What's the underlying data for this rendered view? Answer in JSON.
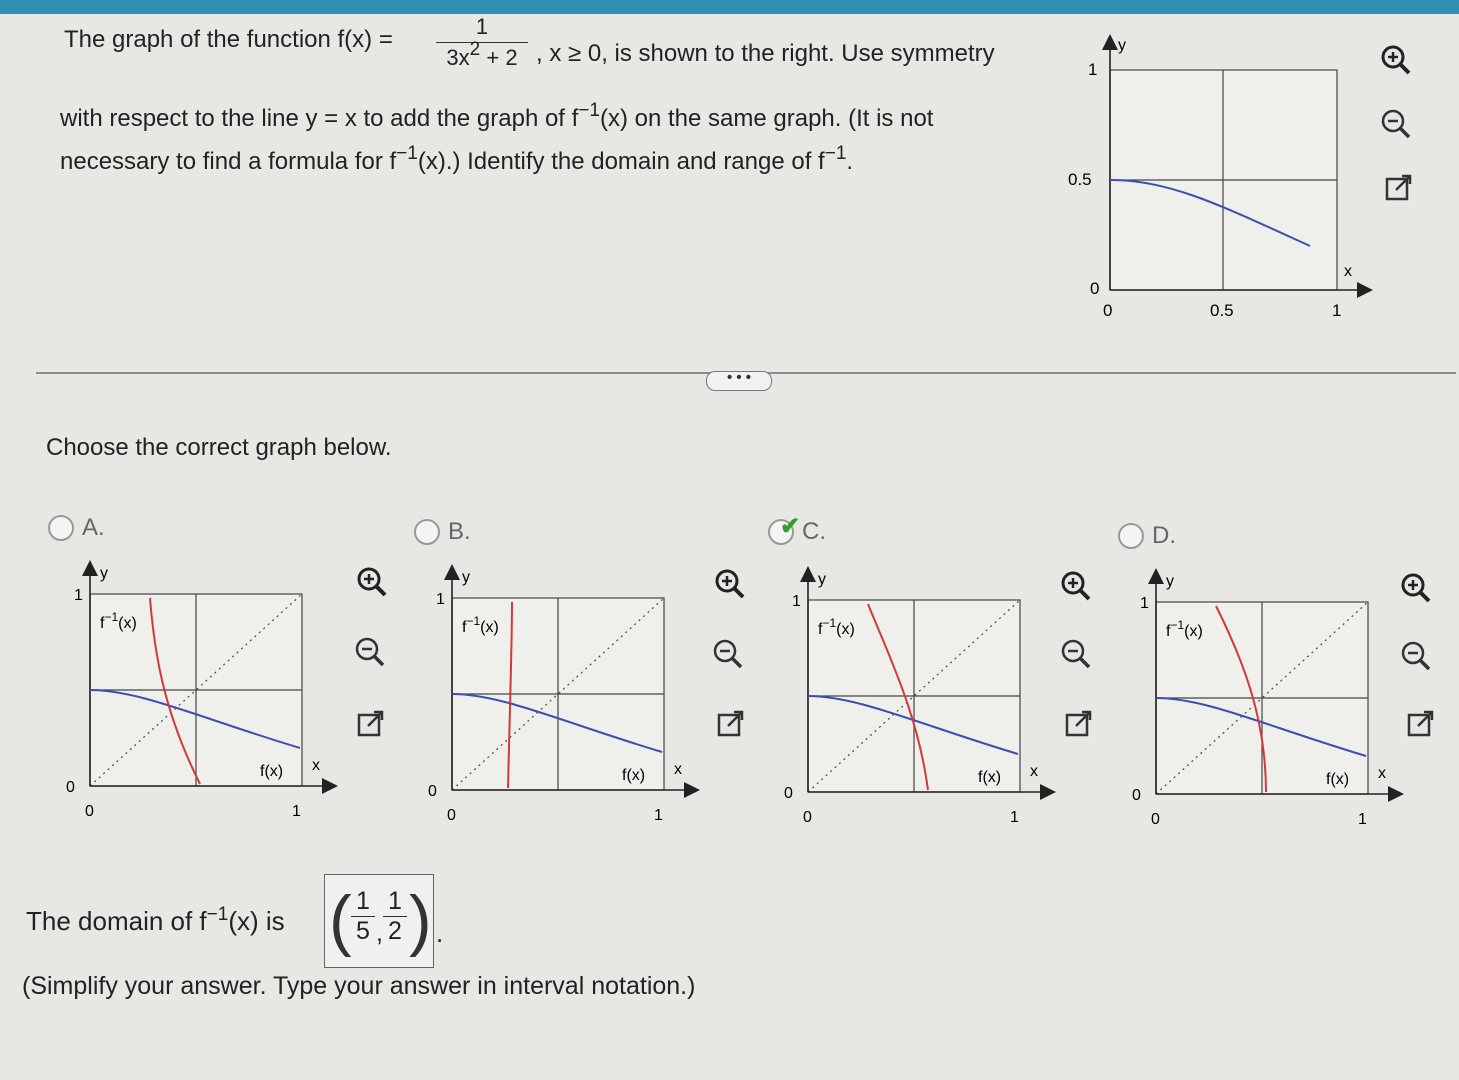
{
  "question": {
    "intro": "The graph of the function f(x) =",
    "numerator": "1",
    "denominator_base": "3x",
    "denominator_exp": "2",
    "denominator_rest": " + 2",
    "condition": ", x ≥ 0, is shown to the right.  Use symmetry",
    "line2_a": "with respect to the line y = x to add the graph of f",
    "line2_b": "(x) on the same graph. (It is not",
    "line3_a": "necessary to find a formula for f",
    "line3_b": "(x).) Identify the domain and range of f",
    "line3_c": ".",
    "inv_exp": "−1"
  },
  "main_graph": {
    "y_label": "y",
    "x_label": "x",
    "y_tick_1": "1",
    "y_tick_half": "0.5",
    "y_tick_0": "0",
    "x_tick_0": "0",
    "x_tick_half": "0.5",
    "x_tick_1": "1",
    "line_color": "#3f4fb0"
  },
  "more_button": "• • •",
  "prompt": "Choose the correct graph below.",
  "options": [
    {
      "letter": "A.",
      "selected": false
    },
    {
      "letter": "B.",
      "selected": false
    },
    {
      "letter": "C.",
      "selected": true,
      "mark": "✔"
    },
    {
      "letter": "D.",
      "selected": false
    }
  ],
  "option_graph_labels": {
    "y": "y",
    "x": "x",
    "one": "1",
    "zero": "0",
    "fx": "f(x)",
    "finv_base": "f",
    "finv_exp": "−1",
    "finv_arg": "(x)"
  },
  "colors": {
    "f_curve": "#3d4db0",
    "finv_curve": "#d23a3a",
    "correct": "#2f9e32"
  },
  "answer": {
    "label_a": "The domain of f",
    "label_exp": "−1",
    "label_b": "(x) is",
    "frac1_num": "1",
    "frac1_den": "5",
    "frac2_num": "1",
    "frac2_den": "2",
    "open": "(",
    "close": ")",
    "comma": ",",
    "end": "."
  },
  "hint": "(Simplify your answer. Type your answer in interval notation.)",
  "icons": [
    "zoom-in-icon",
    "zoom-out-icon",
    "open-external-icon"
  ]
}
